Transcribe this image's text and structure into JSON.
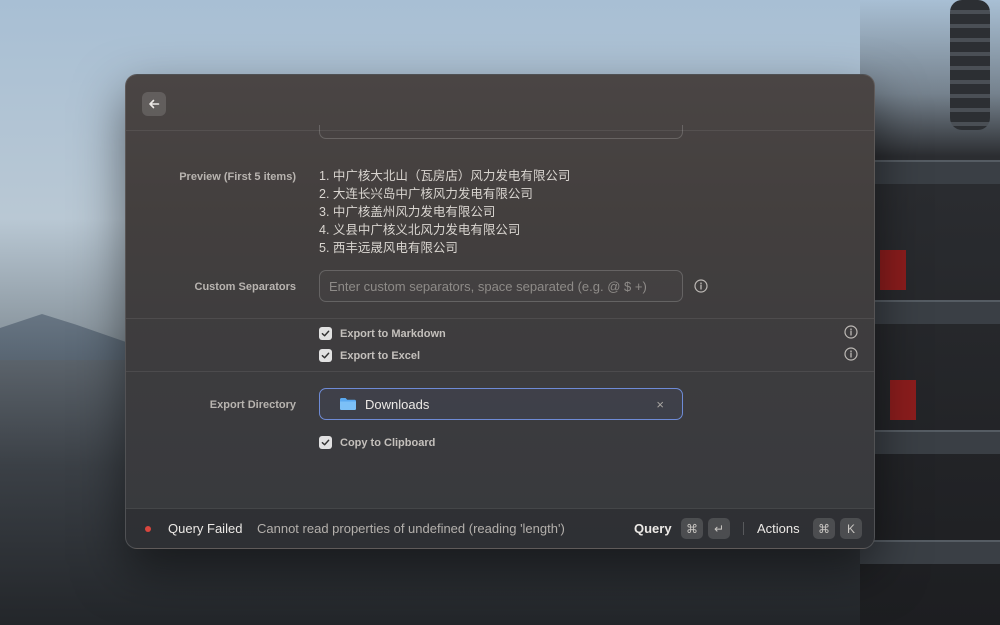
{
  "window": {
    "back_icon": "arrow-left-icon"
  },
  "preview": {
    "label": "Preview (First 5 items)",
    "items": [
      "1. 中广核大北山（瓦房店）风力发电有限公司",
      "2. 大连长兴岛中广核风力发电有限公司",
      "3. 中广核盖州风力发电有限公司",
      "4. 义县中广核义北风力发电有限公司",
      "5. 西丰远晟风电有限公司"
    ]
  },
  "separators": {
    "label": "Custom Separators",
    "placeholder": "Enter custom separators, space separated (e.g. @ $ +)",
    "info_icon": "info-icon"
  },
  "exports": [
    {
      "label": "Export to Markdown",
      "checked": true
    },
    {
      "label": "Export to Excel",
      "checked": true
    }
  ],
  "directory": {
    "label": "Export Directory",
    "value": "Downloads",
    "clear_symbol": "×",
    "folder_icon": "folder-icon"
  },
  "clipboard": {
    "label": "Copy to Clipboard",
    "checked": true
  },
  "footer": {
    "status_title": "Query Failed",
    "status_message": "Cannot read properties of undefined (reading 'length')",
    "status_color": "#d9463e",
    "primary_action": "Query",
    "primary_keys": [
      "⌘",
      "↵"
    ],
    "secondary_action": "Actions",
    "secondary_keys": [
      "⌘",
      "K"
    ]
  },
  "colors": {
    "accent_border": "#6e8bd6",
    "folder": "#5aa9f0"
  }
}
